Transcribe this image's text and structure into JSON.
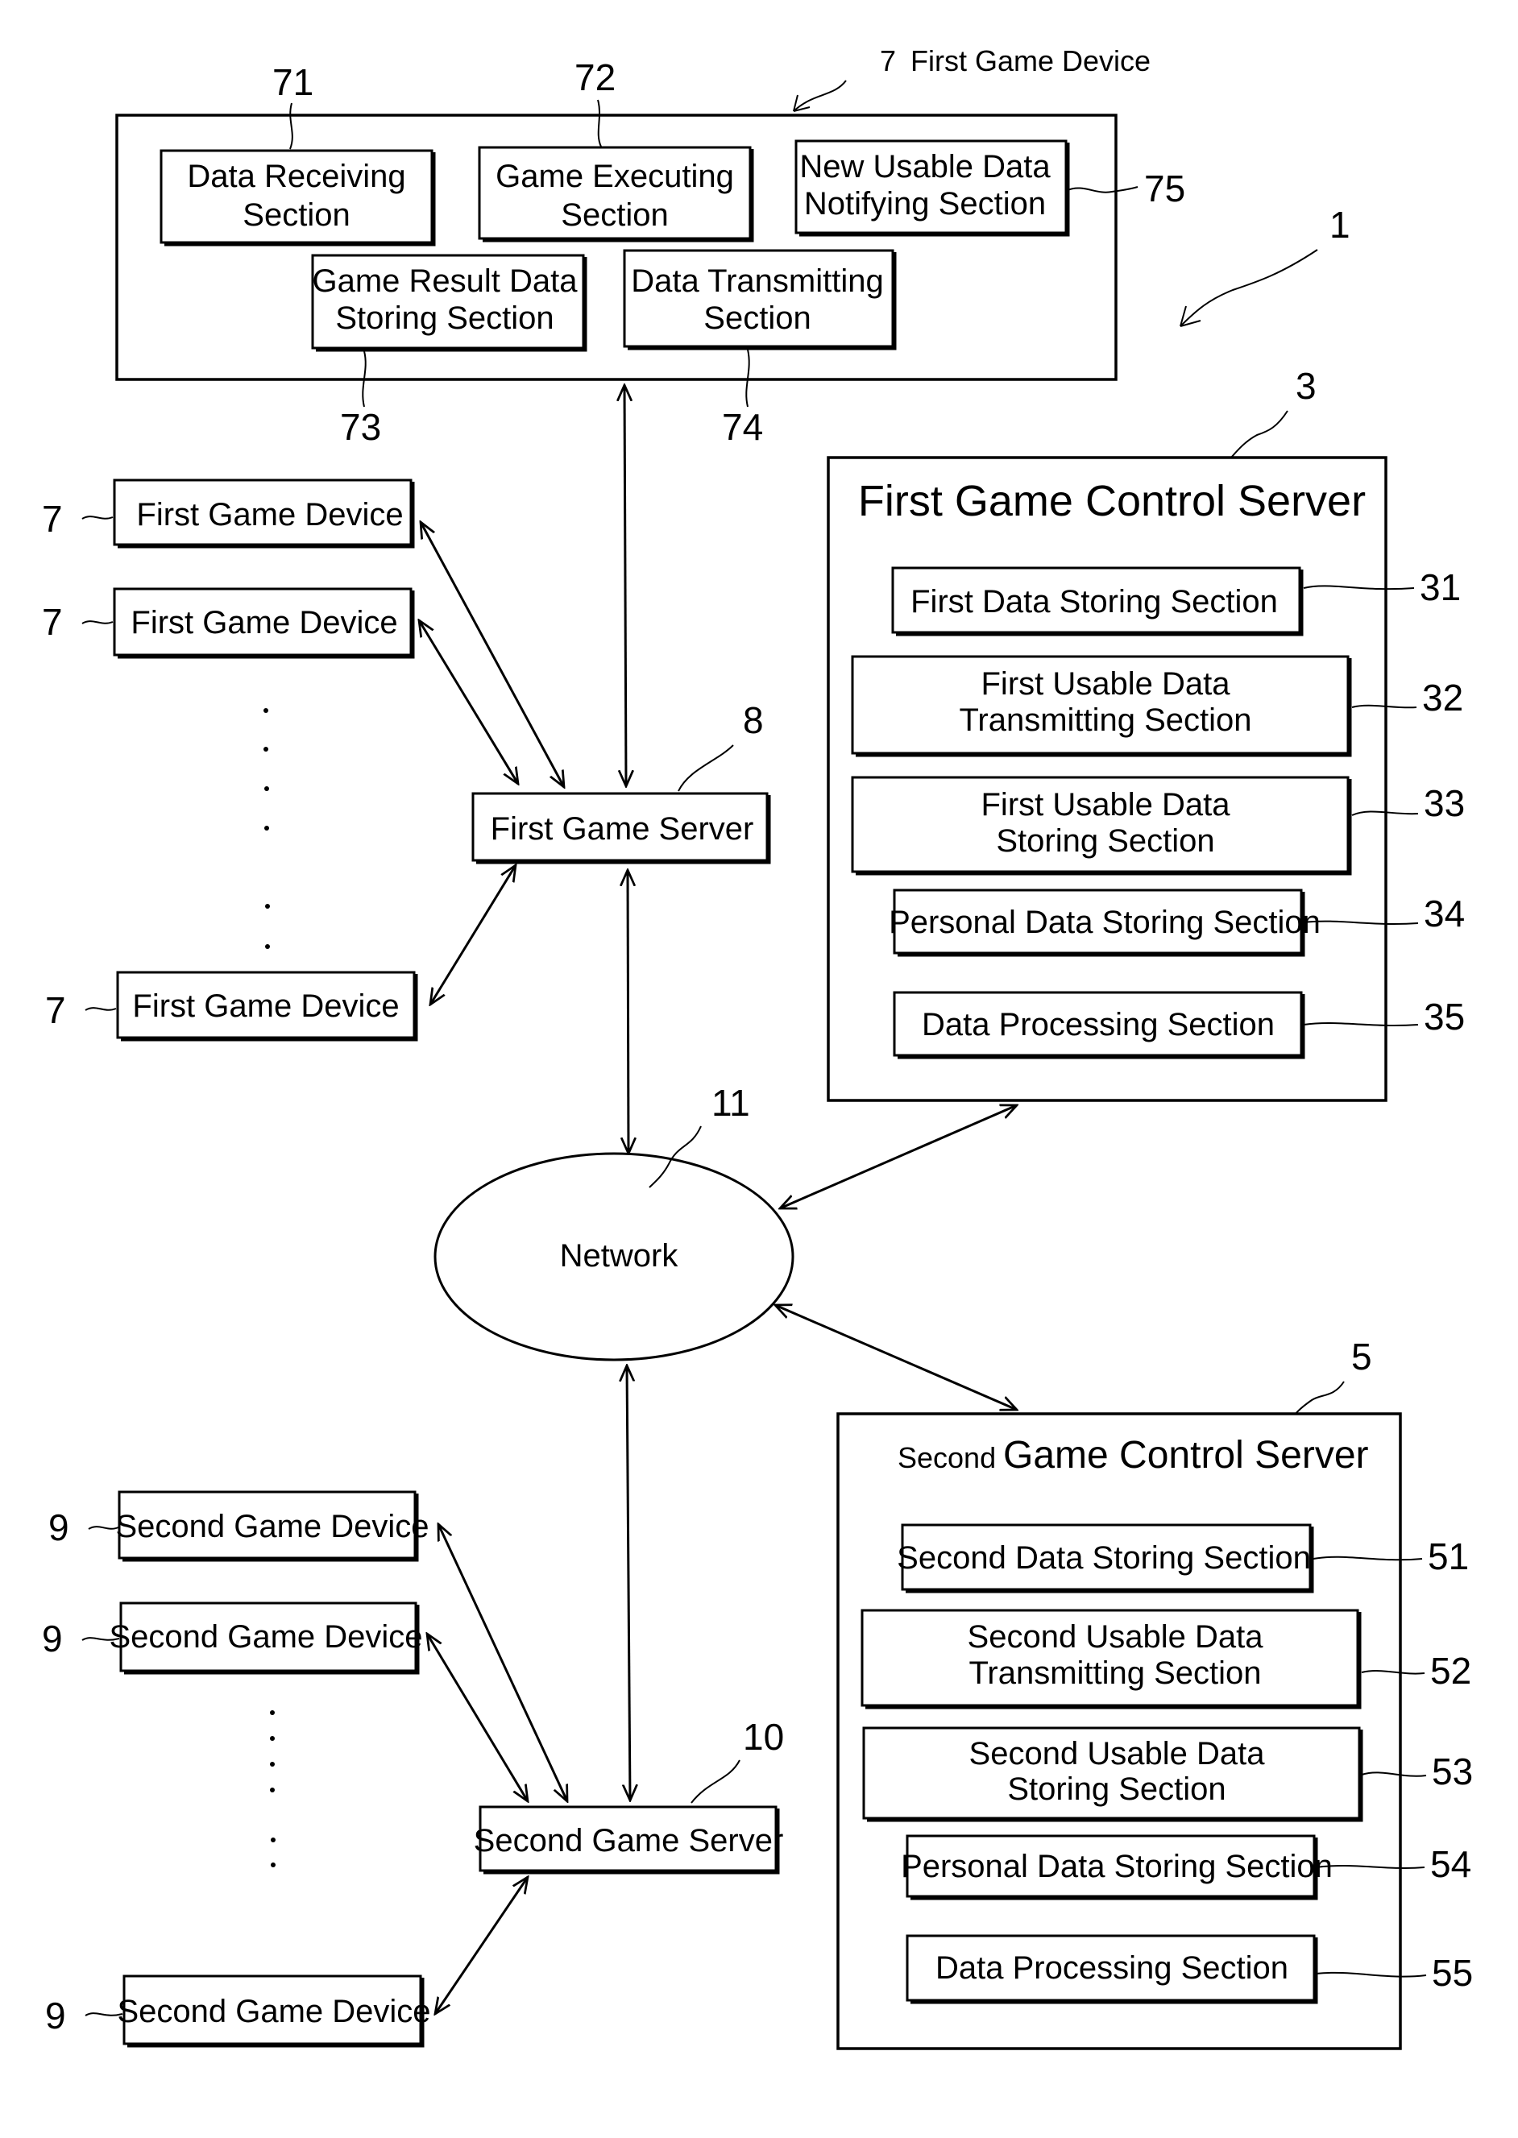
{
  "figure": {
    "system_ref": "1",
    "first_game_device_detail": {
      "ref": "7",
      "title": "First Game Device",
      "sections": [
        {
          "ref": "71",
          "lines": [
            "Data Receiving",
            "Section"
          ]
        },
        {
          "ref": "72",
          "lines": [
            "Game Executing",
            "Section"
          ]
        },
        {
          "ref": "75",
          "lines": [
            "New Usable Data",
            "Notifying Section"
          ]
        },
        {
          "ref": "73",
          "lines": [
            "Game Result Data",
            "Storing Section"
          ]
        },
        {
          "ref": "74",
          "lines": [
            "Data Transmitting",
            "Section"
          ]
        }
      ]
    },
    "first_game_devices": [
      {
        "ref": "7",
        "label": "First Game Device"
      },
      {
        "ref": "7",
        "label": "First Game Device"
      },
      {
        "ref": "7",
        "label": "First Game Device"
      }
    ],
    "first_game_server": {
      "ref": "8",
      "label": "First Game Server"
    },
    "first_game_control_server": {
      "ref": "3",
      "title": "First Game Control Server",
      "sections": [
        {
          "ref": "31",
          "lines": [
            "First Data Storing Section"
          ]
        },
        {
          "ref": "32",
          "lines": [
            "First Usable Data",
            "Transmitting Section"
          ]
        },
        {
          "ref": "33",
          "lines": [
            "First Usable Data",
            "Storing Section"
          ]
        },
        {
          "ref": "34",
          "lines": [
            "Personal Data Storing Section"
          ]
        },
        {
          "ref": "35",
          "lines": [
            "Data Processing Section"
          ]
        }
      ]
    },
    "network": {
      "ref": "11",
      "label": "Network"
    },
    "second_game_devices": [
      {
        "ref": "9",
        "label": "Second Game Device"
      },
      {
        "ref": "9",
        "label": "Second Game Device"
      },
      {
        "ref": "9",
        "label": "Second Game Device"
      }
    ],
    "second_game_server": {
      "ref": "10",
      "label": "Second Game Server"
    },
    "second_game_control_server": {
      "ref": "5",
      "title_prefix": "Second",
      "title_rest": "Game Control Server",
      "sections": [
        {
          "ref": "51",
          "lines": [
            "Second Data Storing Section"
          ]
        },
        {
          "ref": "52",
          "lines": [
            "Second Usable Data",
            "Transmitting Section"
          ]
        },
        {
          "ref": "53",
          "lines": [
            "Second Usable Data",
            "Storing Section"
          ]
        },
        {
          "ref": "54",
          "lines": [
            "Personal Data Storing Section"
          ]
        },
        {
          "ref": "55",
          "lines": [
            "Data Processing Section"
          ]
        }
      ]
    }
  }
}
